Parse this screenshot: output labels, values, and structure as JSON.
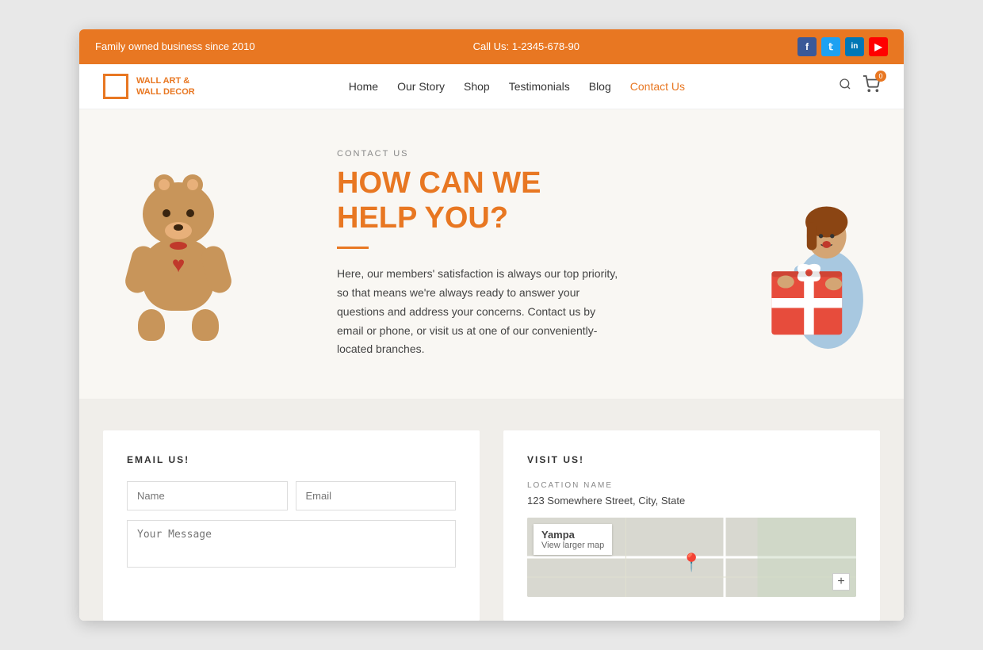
{
  "topBar": {
    "leftText": "Family owned business since 2010",
    "centerText": "Call Us: 1-2345-678-90",
    "social": [
      {
        "name": "Facebook",
        "short": "f",
        "type": "fb"
      },
      {
        "name": "Twitter",
        "short": "t",
        "type": "tw"
      },
      {
        "name": "LinkedIn",
        "short": "in",
        "type": "li"
      },
      {
        "name": "YouTube",
        "short": "▶",
        "type": "yt"
      }
    ]
  },
  "navbar": {
    "logoLine1": "WALL ART &",
    "logoLine2": "WALL DECOR",
    "links": [
      {
        "label": "Home",
        "active": false
      },
      {
        "label": "Our Story",
        "active": false
      },
      {
        "label": "Shop",
        "active": false
      },
      {
        "label": "Testimonials",
        "active": false
      },
      {
        "label": "Blog",
        "active": false
      },
      {
        "label": "Contact Us",
        "active": true
      }
    ],
    "cartCount": "0"
  },
  "hero": {
    "contactLabel": "CONTACT US",
    "title": "HOW CAN WE HELP YOU?",
    "description": "Here, our members' satisfaction is always our top priority, so that means we're always ready to answer your questions and address your concerns. Contact us by email or phone, or visit us at one of our conveniently-located branches."
  },
  "emailSection": {
    "label": "EMAIL US!",
    "namePlaceholder": "Name",
    "emailPlaceholder": "Email",
    "messagePlaceholder": "Your Message"
  },
  "visitSection": {
    "label": "VISIT US!",
    "locationLabel": "LOCATION NAME",
    "address": "123 Somewhere Street, City, State",
    "mapCity": "Yampa",
    "mapLink": "View larger map",
    "mapPlus": "+"
  },
  "colors": {
    "orange": "#E87722",
    "dark": "#333333",
    "lightBg": "#f9f7f3"
  }
}
